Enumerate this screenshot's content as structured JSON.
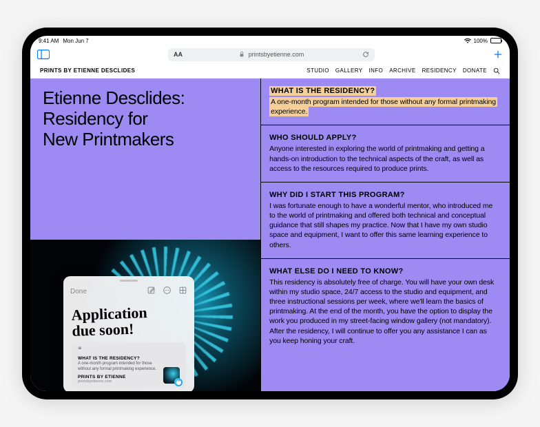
{
  "status": {
    "time": "9:41 AM",
    "date": "Mon Jun 7",
    "battery": "100%"
  },
  "safari": {
    "url": "printsbyetienne.com"
  },
  "site": {
    "logo": "PRINTS BY ETIENNE DESCLIDES",
    "nav": [
      "STUDIO",
      "GALLERY",
      "INFO",
      "ARCHIVE",
      "RESIDENCY",
      "DONATE"
    ]
  },
  "page": {
    "title_l1": "Etienne Desclides:",
    "title_l2": "Residency for",
    "title_l3": "New Printmakers"
  },
  "faqs": [
    {
      "q": "WHAT IS THE RESIDENCY?",
      "a": "A one-month program intended for those without any formal printmaking experience.",
      "highlighted": true
    },
    {
      "q": "WHO SHOULD APPLY?",
      "a": "Anyone interested in exploring the world of printmaking and getting a hands-on introduction to the technical aspects of the craft, as well as access to the resources required to produce prints."
    },
    {
      "q": "WHY DID I START THIS PROGRAM?",
      "a": "I was fortunate enough to have a wonderful mentor, who introduced me to the world of printmaking and offered both technical and conceptual guidance that still shapes my practice. Now that I have my own studio space and equipment, I want to offer this same learning experience to others."
    },
    {
      "q": "WHAT ELSE DO I NEED TO KNOW?",
      "a": "This residency is absolutely free of charge. You will have your own desk within my studio space, 24/7 access to the studio and equipment, and three instructional sessions per week, where we'll learn the basics of printmaking. At the end of the month, you have the option to display the work you produced in my street-facing window gallery (not mandatory). After the residency, I will continue to offer you any assistance I can as you keep honing your craft."
    }
  ],
  "quicknote": {
    "done": "Done",
    "handwriting_l1": "Application",
    "handwriting_l2": "due soon!",
    "link_title": "WHAT IS THE RESIDENCY?",
    "link_desc": "A one-month program intended for those without any formal printmaking experience.",
    "link_src": "PRINTS BY ETIENNE",
    "link_domain": "printsbyetienne.com"
  }
}
